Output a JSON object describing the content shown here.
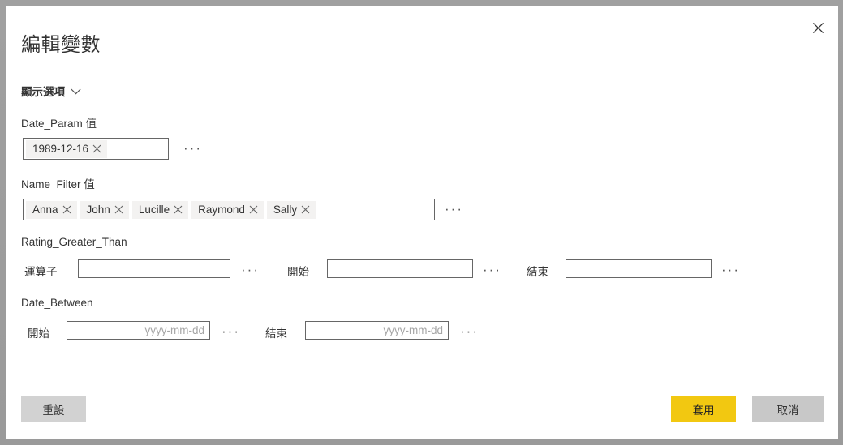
{
  "dialog": {
    "title": "編輯變數",
    "close_icon": "close-icon",
    "show_options": {
      "label": "顯示選項",
      "chevron_icon": "chevron-down-icon"
    }
  },
  "fields": {
    "date_param": {
      "label": "Date_Param 值",
      "tags": [
        {
          "text": "1989-12-16",
          "remove_icon": "close-icon"
        }
      ],
      "more_label": "···"
    },
    "name_filter": {
      "label": "Name_Filter 值",
      "tags": [
        {
          "text": "Anna",
          "remove_icon": "close-icon"
        },
        {
          "text": "John",
          "remove_icon": "close-icon"
        },
        {
          "text": "Lucille",
          "remove_icon": "close-icon"
        },
        {
          "text": "Raymond",
          "remove_icon": "close-icon"
        },
        {
          "text": "Sally",
          "remove_icon": "close-icon"
        }
      ],
      "more_label": "···"
    },
    "rating_greater_than": {
      "label": "Rating_Greater_Than",
      "operator": {
        "label": "運算子",
        "value": "",
        "placeholder": "",
        "more_label": "···"
      },
      "start": {
        "label": "開始",
        "value": "",
        "placeholder": "",
        "more_label": "···"
      },
      "end": {
        "label": "結束",
        "value": "",
        "placeholder": "",
        "more_label": "···"
      }
    },
    "date_between": {
      "label": "Date_Between",
      "start": {
        "label": "開始",
        "value": "",
        "placeholder": "yyyy-mm-dd",
        "more_label": "···"
      },
      "end": {
        "label": "結束",
        "value": "",
        "placeholder": "yyyy-mm-dd",
        "more_label": "···"
      }
    }
  },
  "footer": {
    "reset_label": "重設",
    "apply_label": "套用",
    "cancel_label": "取消"
  },
  "colors": {
    "apply_background": "#f2c811",
    "cancel_background": "#c8c8c8",
    "reset_background": "#d2d2d2",
    "dialog_background": "#ffffff",
    "backdrop": "#9e9e9e",
    "border": "#666666",
    "tag_background": "#f3f2f1",
    "text": "#333333"
  }
}
